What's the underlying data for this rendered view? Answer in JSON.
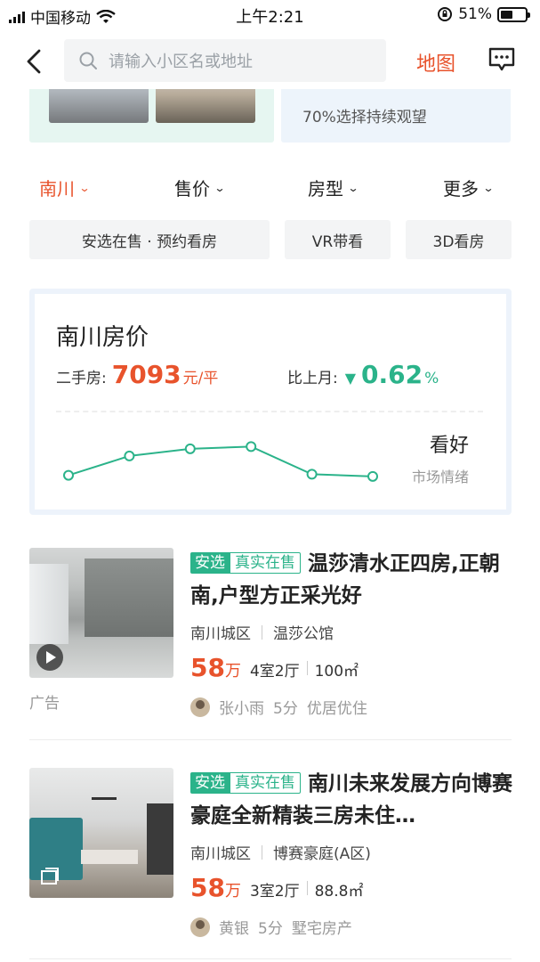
{
  "status_bar": {
    "carrier": "中国移动",
    "time": "上午2:21",
    "battery": "51%",
    "battery_level": 0.51
  },
  "nav": {
    "search_placeholder": "请输入小区名或地址",
    "map_label": "地图"
  },
  "banners": {
    "right_subtitle": "70%选择持续观望"
  },
  "filters": [
    {
      "label": "南川",
      "active": true
    },
    {
      "label": "售价",
      "active": false
    },
    {
      "label": "房型",
      "active": false
    },
    {
      "label": "更多",
      "active": false
    }
  ],
  "tags": [
    "安选在售 · 预约看房",
    "VR带看",
    "3D看房"
  ],
  "price_card": {
    "title": "南川房价",
    "label_secondhand": "二手房:",
    "price": "7093",
    "price_unit": "元/平",
    "label_compare": "比上月:",
    "change": "0.62",
    "change_unit": "%",
    "change_direction": "down",
    "sentiment": "看好",
    "sentiment_label": "市场情绪",
    "trend_color": "#2bb38a",
    "chart_data": {
      "type": "line",
      "x": [
        1,
        2,
        3,
        4,
        5,
        6
      ],
      "values": [
        0.2,
        0.55,
        0.68,
        0.72,
        0.22,
        0.18
      ],
      "title": "",
      "xlabel": "",
      "ylabel": ""
    }
  },
  "listings": [
    {
      "badge_selected": "安选",
      "badge_real": "真实在售",
      "title": "温莎清水正四房,正朝南,户型方正采光好",
      "district": "南川城区",
      "community": "温莎公馆",
      "price_num": "58",
      "price_unit": "万",
      "layout": "4室2厅",
      "area": "100㎡",
      "agent": "张小雨",
      "time": "5分",
      "agency": "优居优住",
      "ad_label": "广告",
      "media_icon": "play-icon"
    },
    {
      "badge_selected": "安选",
      "badge_real": "真实在售",
      "title": "南川未来发展方向博赛豪庭全新精装三房未住…",
      "district": "南川城区",
      "community": "博赛豪庭(A区)",
      "price_num": "58",
      "price_unit": "万",
      "layout": "3室2厅",
      "area": "88.8㎡",
      "agent": "黄银",
      "time": "5分",
      "agency": "墅宅房产",
      "media_icon": "vr-icon"
    }
  ],
  "colors": {
    "accent": "#e8532c",
    "green": "#2bb38a"
  }
}
